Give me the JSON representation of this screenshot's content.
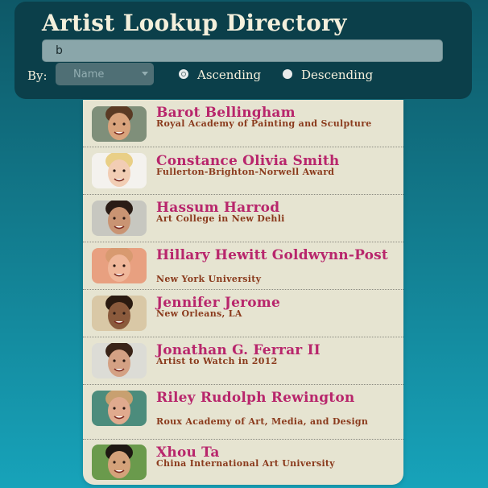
{
  "header": {
    "title": "Artist Lookup Directory",
    "search_value": "b",
    "by_label": "By:",
    "sort_select": "Name",
    "sort_order": {
      "ascending_label": "Ascending",
      "descending_label": "Descending",
      "selected": "Ascending"
    }
  },
  "artists": [
    {
      "name": "Barot Bellingham",
      "reknown": "Royal Academy of Painting and Sculpture",
      "skin": "#d9a37c",
      "hair": "#5a3a24",
      "bg": "#7f8f7a"
    },
    {
      "name": "Constance Olivia Smith",
      "reknown": "Fullerton-Brighton-Norwell Award",
      "skin": "#f2cdb4",
      "hair": "#e9cf86",
      "bg": "#f4f2ee"
    },
    {
      "name": "Hassum Harrod",
      "reknown": "Art College in New Dehli",
      "skin": "#c99473",
      "hair": "#2a1c16",
      "bg": "#c7c7c0"
    },
    {
      "name": "Hillary Hewitt Goldwynn-Post",
      "reknown": "New York University",
      "skin": "#f0b79a",
      "hair": "#d89a70",
      "bg": "#e8a080"
    },
    {
      "name": "Jennifer Jerome",
      "reknown": "New Orleans, LA",
      "skin": "#8a5a3c",
      "hair": "#2a1a10",
      "bg": "#d9c8a6"
    },
    {
      "name": "Jonathan G. Ferrar II",
      "reknown": "Artist to Watch in 2012",
      "skin": "#d4a184",
      "hair": "#3a2418",
      "bg": "#dcdcd6"
    },
    {
      "name": "Riley Rudolph Rewington",
      "reknown": "Roux Academy of Art, Media, and Design",
      "skin": "#e0aa8e",
      "hair": "#c8a070",
      "bg": "#4c8c7c"
    },
    {
      "name": "Xhou Ta",
      "reknown": "China International Art University",
      "skin": "#d4a27a",
      "hair": "#1e1812",
      "bg": "#6a9a4c"
    }
  ]
}
